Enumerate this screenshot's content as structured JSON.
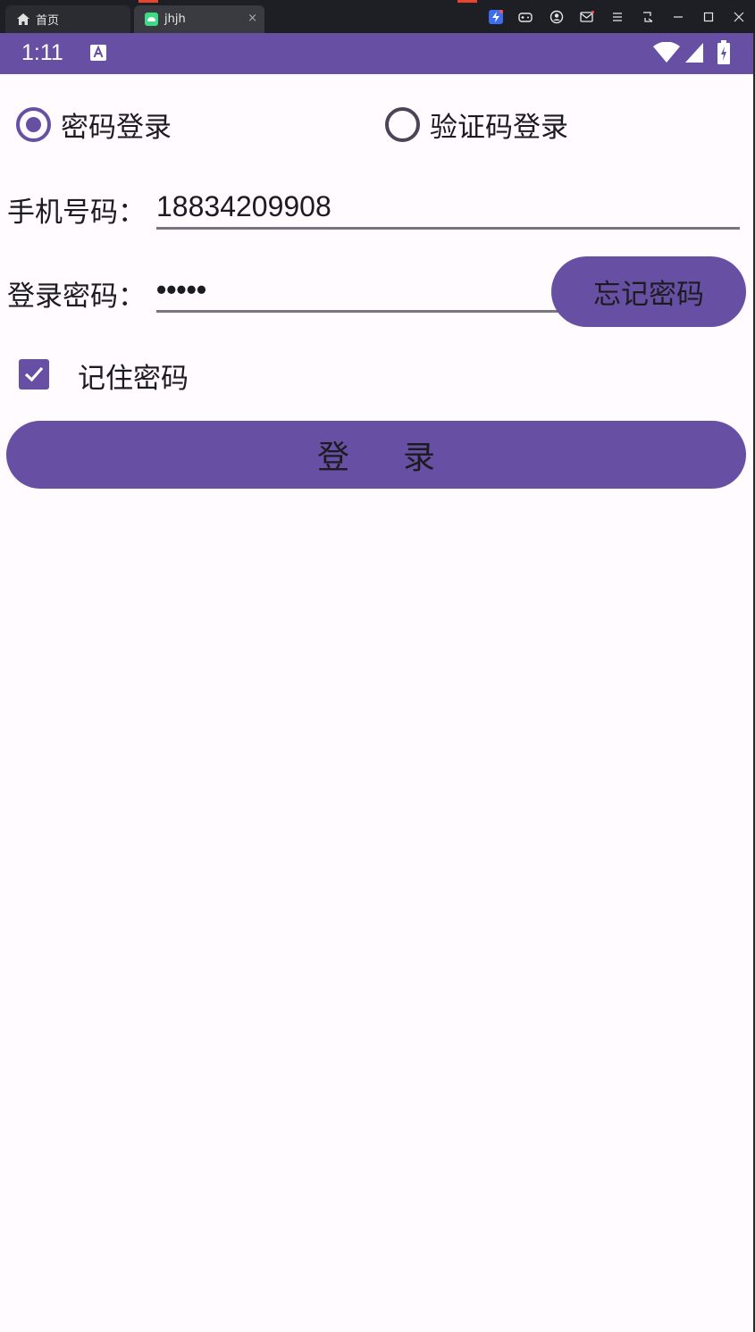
{
  "window": {
    "tabs": [
      {
        "label": "首页",
        "icon": "home-icon"
      },
      {
        "label": "jhjh",
        "icon": "android-icon",
        "close": "×"
      }
    ],
    "controls": [
      "minimize",
      "maximize",
      "close"
    ]
  },
  "status_bar": {
    "time": "1:11",
    "icons": [
      "keyboard-a-icon",
      "wifi-icon",
      "signal-icon",
      "battery-charging-icon"
    ]
  },
  "login_mode": {
    "options": [
      {
        "label": "密码登录",
        "checked": true
      },
      {
        "label": "验证码登录",
        "checked": false
      }
    ]
  },
  "phone": {
    "label": "手机号码：",
    "value": "18834209908"
  },
  "password": {
    "label": "登录密码：",
    "value": "•••••",
    "forgot_label": "忘记密码"
  },
  "remember": {
    "label": "记住密码",
    "checked": true
  },
  "submit": {
    "label": "登      录"
  },
  "colors": {
    "primary": "#6750a4",
    "background": "#fffbfe",
    "text": "#1c1b1f",
    "underline": "#79747e"
  }
}
